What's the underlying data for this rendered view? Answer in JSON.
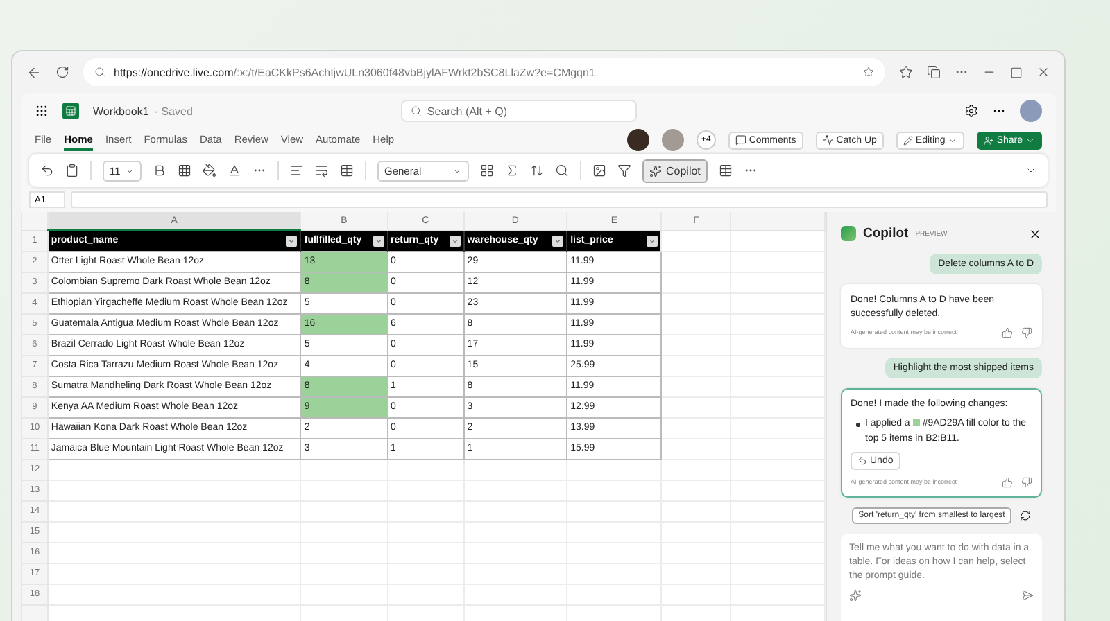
{
  "browser": {
    "url_host": "https://onedrive.live.com",
    "url_path": "/:x:/t/EaCKkPs6AchIjwULn3060f48vbBjylAFWrkt2bSC8LlaZw?e=CMgqn1"
  },
  "app": {
    "workbook": "Workbook1",
    "status": "· Saved",
    "search_placeholder": "Search (Alt + Q)"
  },
  "tabs": [
    {
      "label": "File",
      "selected": false
    },
    {
      "label": "Home",
      "selected": true
    },
    {
      "label": "Insert",
      "selected": false
    },
    {
      "label": "Formulas",
      "selected": false
    },
    {
      "label": "Data",
      "selected": false
    },
    {
      "label": "Review",
      "selected": false
    },
    {
      "label": "View",
      "selected": false
    },
    {
      "label": "Automate",
      "selected": false
    },
    {
      "label": "Help",
      "selected": false
    }
  ],
  "collab": {
    "more_count": "+4",
    "comments": "Comments",
    "catch_up": "Catch Up",
    "editing": "Editing",
    "share": "Share"
  },
  "ribbon": {
    "font_size": "11",
    "number_format": "General",
    "copilot": {
      "label": "Copilot",
      "selected": true
    }
  },
  "formula_bar": {
    "cell_ref": "A1"
  },
  "sheet": {
    "columns": [
      {
        "letter": "A",
        "selected": true
      },
      {
        "letter": "B",
        "selected": false
      },
      {
        "letter": "C",
        "selected": false
      },
      {
        "letter": "D",
        "selected": false
      },
      {
        "letter": "E",
        "selected": false
      },
      {
        "letter": "F",
        "selected": false
      }
    ],
    "header": {
      "number": "1",
      "cells": [
        "product_name",
        "fullfilled_qty",
        "return_qty",
        "warehouse_qty",
        "list_price"
      ]
    },
    "rows": [
      {
        "number": "2",
        "cells": [
          {
            "text": "Otter Light Roast Whole Bean 12oz",
            "highlighted": false
          },
          {
            "text": "13",
            "highlighted": true
          },
          {
            "text": "0",
            "highlighted": false
          },
          {
            "text": "29",
            "highlighted": false
          },
          {
            "text": "11.99",
            "highlighted": false
          }
        ]
      },
      {
        "number": "3",
        "cells": [
          {
            "text": "Colombian Supremo Dark Roast Whole Bean 12oz",
            "highlighted": false
          },
          {
            "text": "8",
            "highlighted": true
          },
          {
            "text": "0",
            "highlighted": false
          },
          {
            "text": "12",
            "highlighted": false
          },
          {
            "text": "11.99",
            "highlighted": false
          }
        ]
      },
      {
        "number": "4",
        "cells": [
          {
            "text": "Ethiopian Yirgacheffe Medium Roast Whole Bean 12oz",
            "highlighted": false
          },
          {
            "text": "5",
            "highlighted": false
          },
          {
            "text": "0",
            "highlighted": false
          },
          {
            "text": "23",
            "highlighted": false
          },
          {
            "text": "11.99",
            "highlighted": false
          }
        ]
      },
      {
        "number": "5",
        "cells": [
          {
            "text": "Guatemala Antigua Medium Roast Whole Bean 12oz",
            "highlighted": false
          },
          {
            "text": "16",
            "highlighted": true
          },
          {
            "text": "6",
            "highlighted": false
          },
          {
            "text": "8",
            "highlighted": false
          },
          {
            "text": "11.99",
            "highlighted": false
          }
        ]
      },
      {
        "number": "6",
        "cells": [
          {
            "text": "Brazil Cerrado Light Roast Whole Bean 12oz",
            "highlighted": false
          },
          {
            "text": "5",
            "highlighted": false
          },
          {
            "text": "0",
            "highlighted": false
          },
          {
            "text": "17",
            "highlighted": false
          },
          {
            "text": "11.99",
            "highlighted": false
          }
        ]
      },
      {
        "number": "7",
        "cells": [
          {
            "text": "Costa Rica Tarrazu Medium Roast Whole Bean 12oz",
            "highlighted": false
          },
          {
            "text": "4",
            "highlighted": false
          },
          {
            "text": "0",
            "highlighted": false
          },
          {
            "text": "15",
            "highlighted": false
          },
          {
            "text": "25.99",
            "highlighted": false
          }
        ]
      },
      {
        "number": "8",
        "cells": [
          {
            "text": "Sumatra Mandheling Dark Roast Whole Bean 12oz",
            "highlighted": false
          },
          {
            "text": "8",
            "highlighted": true
          },
          {
            "text": "1",
            "highlighted": false
          },
          {
            "text": "8",
            "highlighted": false
          },
          {
            "text": "11.99",
            "highlighted": false
          }
        ]
      },
      {
        "number": "9",
        "cells": [
          {
            "text": "Kenya AA Medium Roast Whole Bean 12oz",
            "highlighted": false
          },
          {
            "text": "9",
            "highlighted": true
          },
          {
            "text": "0",
            "highlighted": false
          },
          {
            "text": "3",
            "highlighted": false
          },
          {
            "text": "12.99",
            "highlighted": false
          }
        ]
      },
      {
        "number": "10",
        "cells": [
          {
            "text": "Hawaiian Kona Dark Roast Whole Bean 12oz",
            "highlighted": false
          },
          {
            "text": "2",
            "highlighted": false
          },
          {
            "text": "0",
            "highlighted": false
          },
          {
            "text": "2",
            "highlighted": false
          },
          {
            "text": "13.99",
            "highlighted": false
          }
        ]
      },
      {
        "number": "11",
        "cells": [
          {
            "text": "Jamaica Blue Mountain Light Roast Whole Bean 12oz",
            "highlighted": false
          },
          {
            "text": "3",
            "highlighted": false
          },
          {
            "text": "1",
            "highlighted": false
          },
          {
            "text": "1",
            "highlighted": false
          },
          {
            "text": "15.99",
            "highlighted": false
          }
        ]
      }
    ],
    "empty_rows": [
      "12",
      "13",
      "14",
      "15",
      "16",
      "17",
      "18"
    ]
  },
  "copilot": {
    "title": "Copilot",
    "badge": "PREVIEW",
    "messages": [
      {
        "kind": "user",
        "text": "Delete columns A to D"
      },
      {
        "kind": "assistant",
        "active": false,
        "text": "Done! Columns A to D have been successfully deleted.",
        "disclaimer": "AI-generated content may be incorrect"
      },
      {
        "kind": "user",
        "text": "Highlight the most shipped items"
      },
      {
        "kind": "assistant",
        "active": true,
        "text": "Done! I made the following changes:",
        "bullet_before": "I applied a",
        "color_code": "#9AD29A",
        "bullet_after": "fill color to the top 5 items in B2:B11.",
        "undo": "Undo",
        "disclaimer": "AI-generated content may be incorrect"
      }
    ],
    "suggestion": "Sort 'return_qty' from smallest to largest",
    "input_placeholder": "Tell me what you want to do with data in a table. For ideas on how I can help, select the prompt guide."
  }
}
